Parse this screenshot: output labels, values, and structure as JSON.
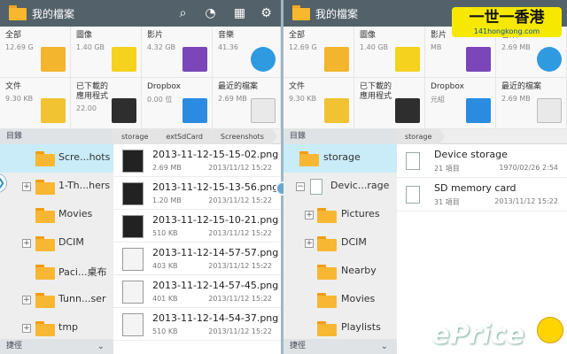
{
  "left": {
    "title": "我的檔案",
    "categories": [
      {
        "name": "全部",
        "size": "12.69 G"
      },
      {
        "name": "圖像",
        "size": "1.40 GB"
      },
      {
        "name": "影片",
        "size": "4.32 GB"
      },
      {
        "name": "音樂",
        "size": "41.36"
      },
      {
        "name": "文件",
        "size": "9.30 KB"
      },
      {
        "name": "已下載的應用程式",
        "size": "22.00"
      },
      {
        "name": "Dropbox",
        "size": "0.00 位"
      },
      {
        "name": "最近的檔案",
        "size": "2.69 MB"
      }
    ],
    "dirs_label": "目錄",
    "shortcut_label": "捷徑",
    "breadcrumbs": [
      "storage",
      "extSdCard",
      "Screenshots"
    ],
    "tree": [
      "Scre...hots",
      "1-Th...hers",
      "Movies",
      "DCIM",
      "Paci...桌布",
      "Tunn...ser",
      "tmp"
    ],
    "files": [
      {
        "name": "2013-11-12-15-15-02.png",
        "size": "2.69 MB",
        "date": "2013/11/12 15:22"
      },
      {
        "name": "2013-11-12-15-13-56.png",
        "size": "1.20 MB",
        "date": "2013/11/12 15:22"
      },
      {
        "name": "2013-11-12-15-10-21.png",
        "size": "510 KB",
        "date": "2013/11/12 15:22"
      },
      {
        "name": "2013-11-12-14-57-57.png",
        "size": "403 KB",
        "date": "2013/11/12 15:22"
      },
      {
        "name": "2013-11-12-14-57-45.png",
        "size": "401 KB",
        "date": "2013/11/12 15:22"
      },
      {
        "name": "2013-11-12-14-54-37.png",
        "size": "510 KB",
        "date": "2013/11/12 15:22"
      }
    ]
  },
  "right": {
    "title": "我的檔案",
    "categories": [
      {
        "name": "全部",
        "size": "12.69 G"
      },
      {
        "name": "圖像",
        "size": "1.40 GB"
      },
      {
        "name": "影片",
        "size": "MB"
      },
      {
        "name": "音樂",
        "size": "2.69 MB"
      },
      {
        "name": "文件",
        "size": "9.30 KB"
      },
      {
        "name": "已下載的應用程式",
        "size": ""
      },
      {
        "name": "Dropbox",
        "size": "元組"
      },
      {
        "name": "最近的檔案",
        "size": "2.69 MB"
      }
    ],
    "dirs_label": "目錄",
    "shortcut_label": "捷徑",
    "breadcrumbs": [
      "storage"
    ],
    "tree": [
      "storage",
      "Devic...rage",
      "Pictures",
      "DCIM",
      "Nearby",
      "Movies",
      "Playlists"
    ],
    "storages": [
      {
        "name": "Device storage",
        "count": "21 項目",
        "date": "1970/02/26 2:54"
      },
      {
        "name": "SD memory card",
        "count": "31 項目",
        "date": "2013/11/12 15:22"
      }
    ]
  },
  "watermark": {
    "main": "一世一香港",
    "sub": "141hongkong.com",
    "brand": "ePrice"
  }
}
